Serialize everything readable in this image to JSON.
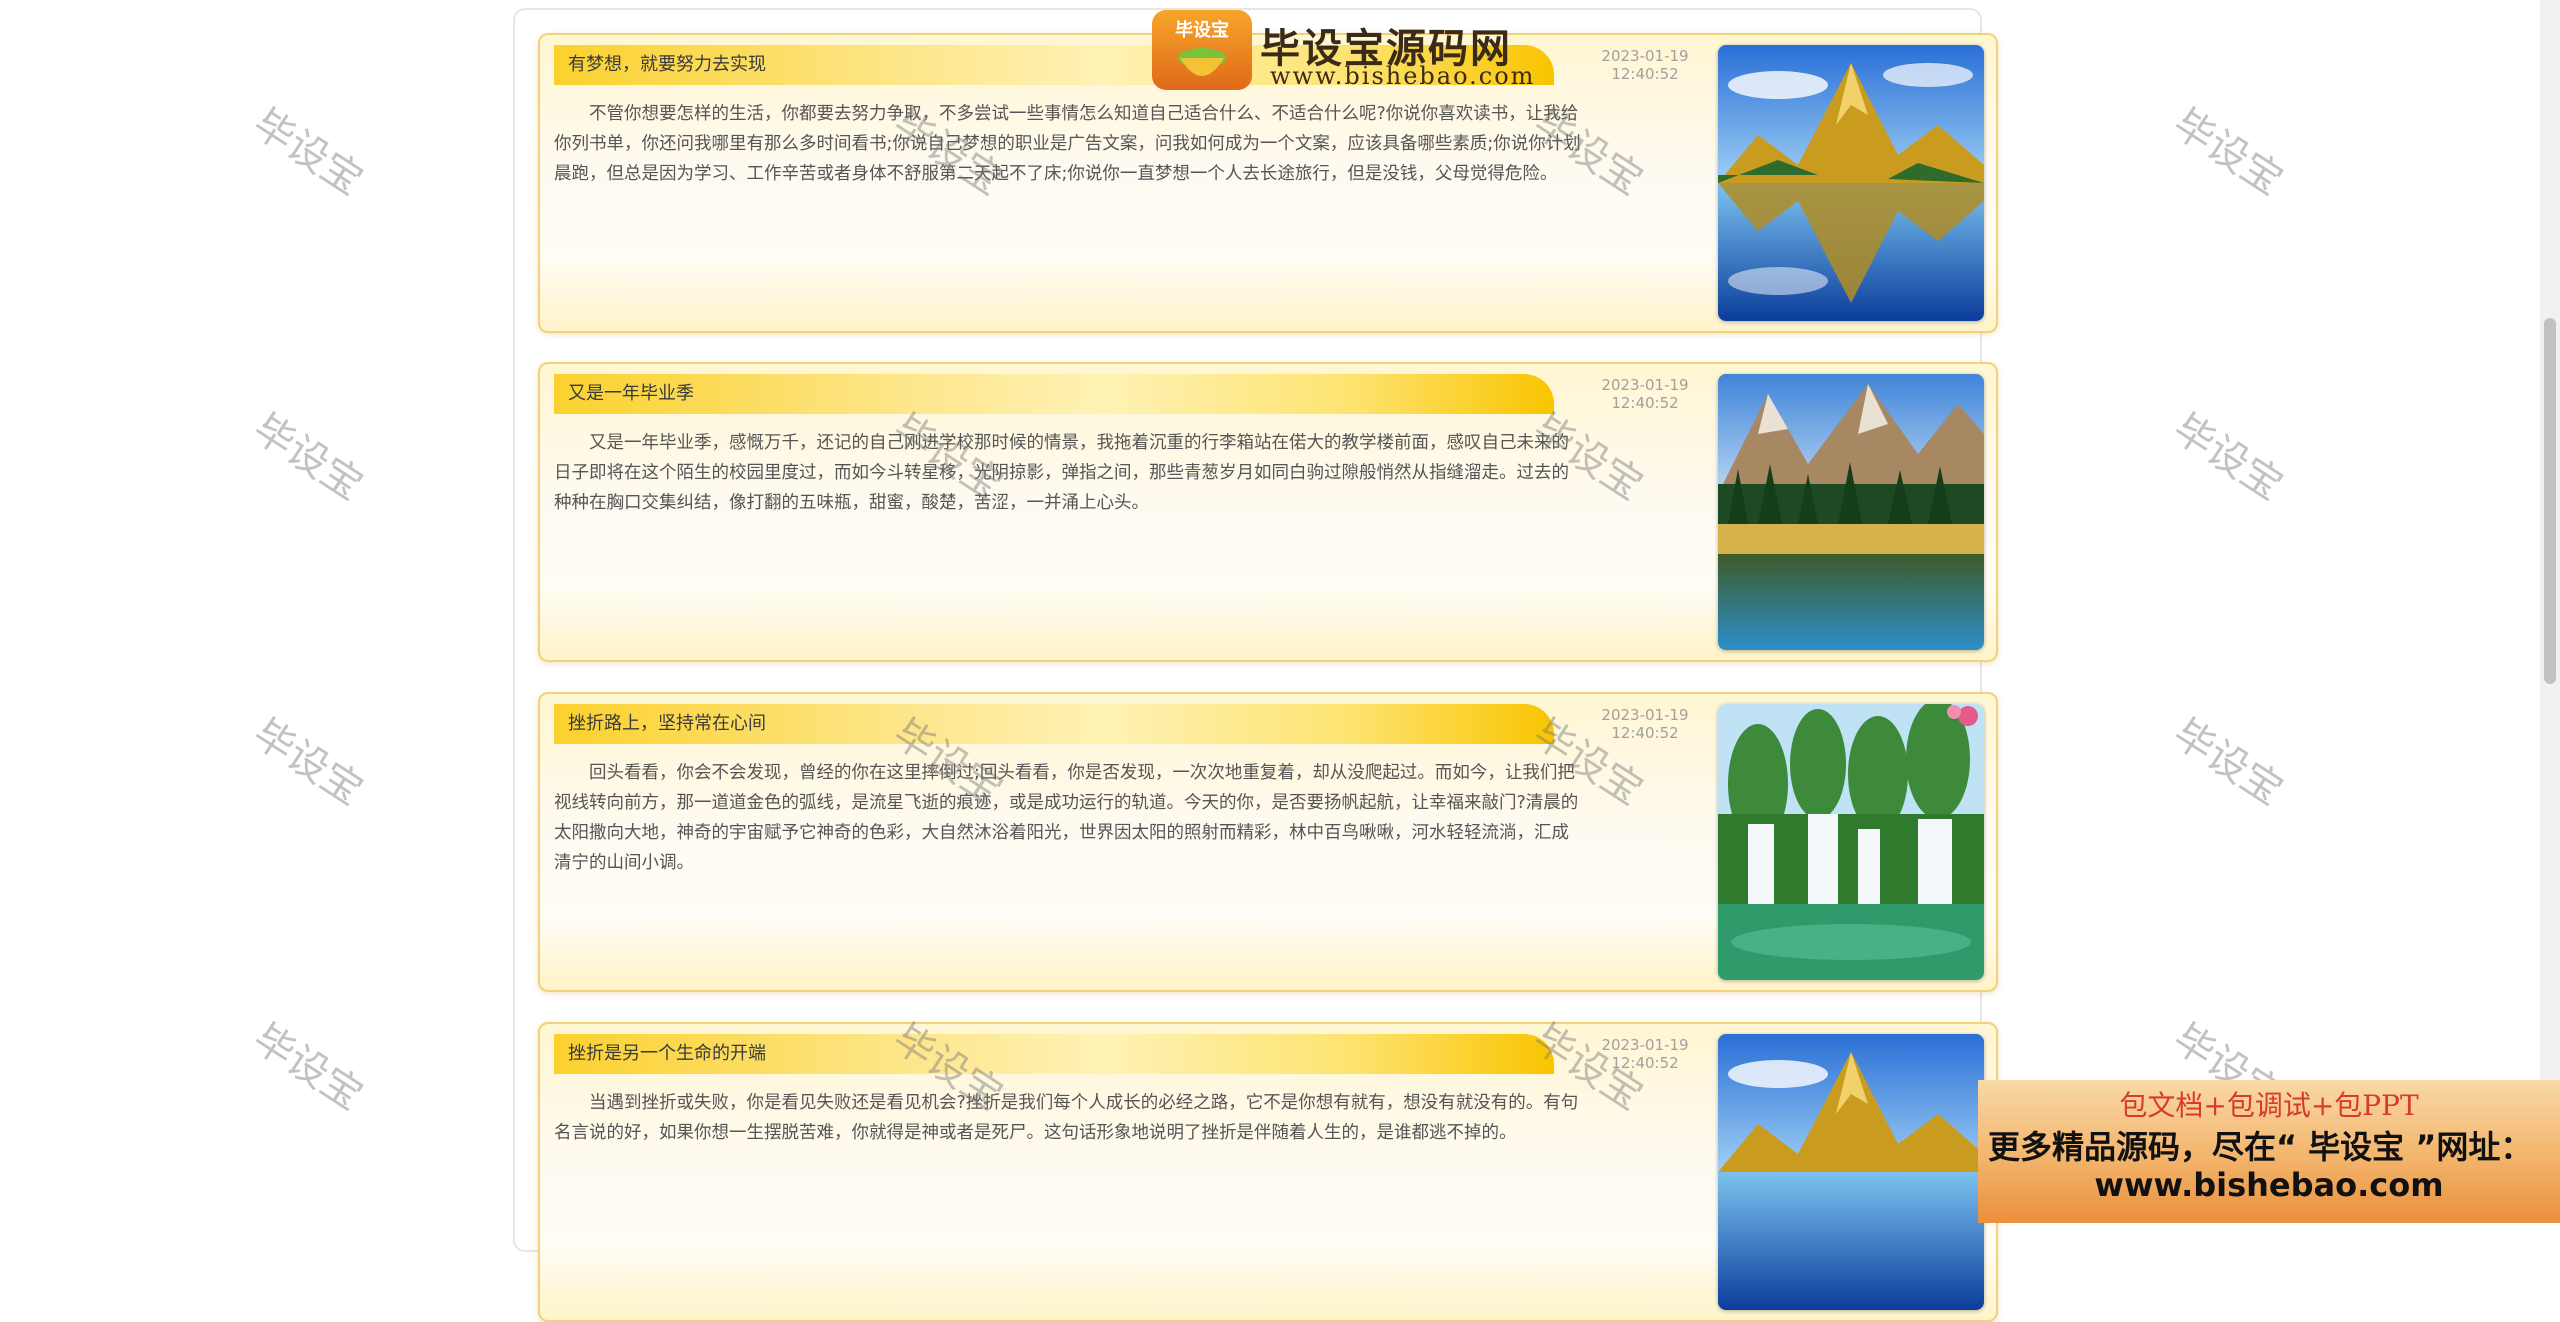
{
  "articles": [
    {
      "title": "有梦想，就要努力去实现",
      "date": "2023-01-19",
      "time": "12:40:52",
      "body": "不管你想要怎样的生活，你都要去努力争取，不多尝试一些事情怎么知道自己适合什么、不适合什么呢?你说你喜欢读书，让我给你列书单，你还问我哪里有那么多时间看书;你说自己梦想的职业是广告文案，问我如何成为一个文案，应该具备哪些素质;你说你计划晨跑，但总是因为学习、工作辛苦或者身体不舒服第二天起不了床;你说你一直梦想一个人去长途旅行，但是没钱，父母觉得危险。",
      "image": "mountain-lake-reflection-image"
    },
    {
      "title": "又是一年毕业季",
      "date": "2023-01-19",
      "time": "12:40:52",
      "body": "又是一年毕业季，感慨万千，还记的自己刚进学校那时候的情景，我拖着沉重的行李箱站在偌大的教学楼前面，感叹自己未来的日子即将在这个陌生的校园里度过，而如今斗转星移，光阴掠影，弹指之间，那些青葱岁月如同白驹过隙般悄然从指缝溜走。过去的种种在胸口交集纠结，像打翻的五味瓶，甜蜜，酸楚，苦涩，一并涌上心头。",
      "image": "forest-lake-mountains-image"
    },
    {
      "title": "挫折路上，坚持常在心间",
      "date": "2023-01-19",
      "time": "12:40:52",
      "body": "回头看看，你会不会发现，曾经的你在这里摔倒过;回头看看，你是否发现，一次次地重复着，却从没爬起过。而如今，让我们把视线转向前方，那一道道金色的弧线，是流星飞逝的痕迹，或是成功运行的轨道。今天的你，是否要扬帆起航，让幸福来敲门?清晨的太阳撒向大地，神奇的宇宙赋予它神奇的色彩，大自然沐浴着阳光，世界因太阳的照射而精彩，林中百鸟啾啾，河水轻轻流淌，汇成清宁的山间小调。",
      "image": "waterfall-landscape-image"
    },
    {
      "title": "挫折是另一个生命的开端",
      "date": "2023-01-19",
      "time": "12:40:52",
      "body": "当遇到挫折或失败，你是看见失败还是看见机会?挫折是我们每个人成长的必经之路，它不是你想有就有，想没有就没有的。有句名言说的好，如果你想一生摆脱苦难，你就得是神或者是死尸。这句话形象地说明了挫折是伴随着人生的，是谁都逃不掉的。",
      "image": "mountain-lake-reflection-image"
    }
  ],
  "logo": {
    "badge": "毕设宝",
    "title": "毕设宝源码网",
    "url": "www.bishebao.com"
  },
  "watermark_text": "毕设宝",
  "promo": {
    "line1": "包文档+包调试+包PPT",
    "line2": "更多精品源码，尽在“ 毕设宝 ”网址：",
    "line3": "www.bishebao.com"
  }
}
